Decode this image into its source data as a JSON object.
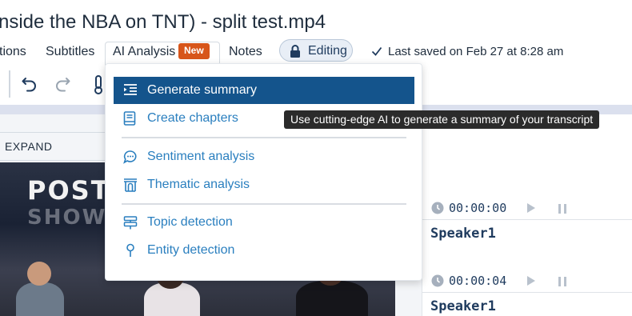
{
  "window": {
    "title": "nside the NBA on TNT) - split test.mp4"
  },
  "menubar": {
    "items": [
      {
        "label": "tions"
      },
      {
        "label": "Subtitles"
      },
      {
        "label": "AI Analysis",
        "badge": "New"
      },
      {
        "label": "Notes"
      }
    ],
    "editing_label": "Editing",
    "saved_text": "Last saved on Feb 27 at 8:28 am"
  },
  "toolbar": {
    "icons": [
      "undo-icon",
      "redo-icon",
      "thermometer-icon"
    ]
  },
  "left_pane": {
    "expand_label": "EXPAND",
    "video": {
      "text_line1": "POST",
      "text_line2": "SHOW"
    }
  },
  "dropdown": {
    "items": [
      {
        "label": "Generate summary",
        "icon": "summary-icon",
        "active": true
      },
      {
        "label": "Create chapters",
        "icon": "book-icon"
      },
      {
        "label": "Sentiment analysis",
        "icon": "chat-bubble-icon"
      },
      {
        "label": "Thematic analysis",
        "icon": "building-icon"
      },
      {
        "label": "Topic detection",
        "icon": "signpost-icon"
      },
      {
        "label": "Entity detection",
        "icon": "pin-icon"
      }
    ]
  },
  "tooltip": {
    "text": "Use cutting-edge AI to generate a summary of your transcript"
  },
  "transcript": {
    "segments": [
      {
        "timestamp": "00:00:00",
        "speaker": "Speaker1"
      },
      {
        "timestamp": "00:00:04",
        "speaker": "Speaker1"
      }
    ]
  },
  "colors": {
    "accent": "#14548c",
    "link": "#2a7fbf",
    "badge": "#d7551a",
    "tooltip_bg": "#2b2b2b",
    "divider_band": "#dbe0ee"
  }
}
